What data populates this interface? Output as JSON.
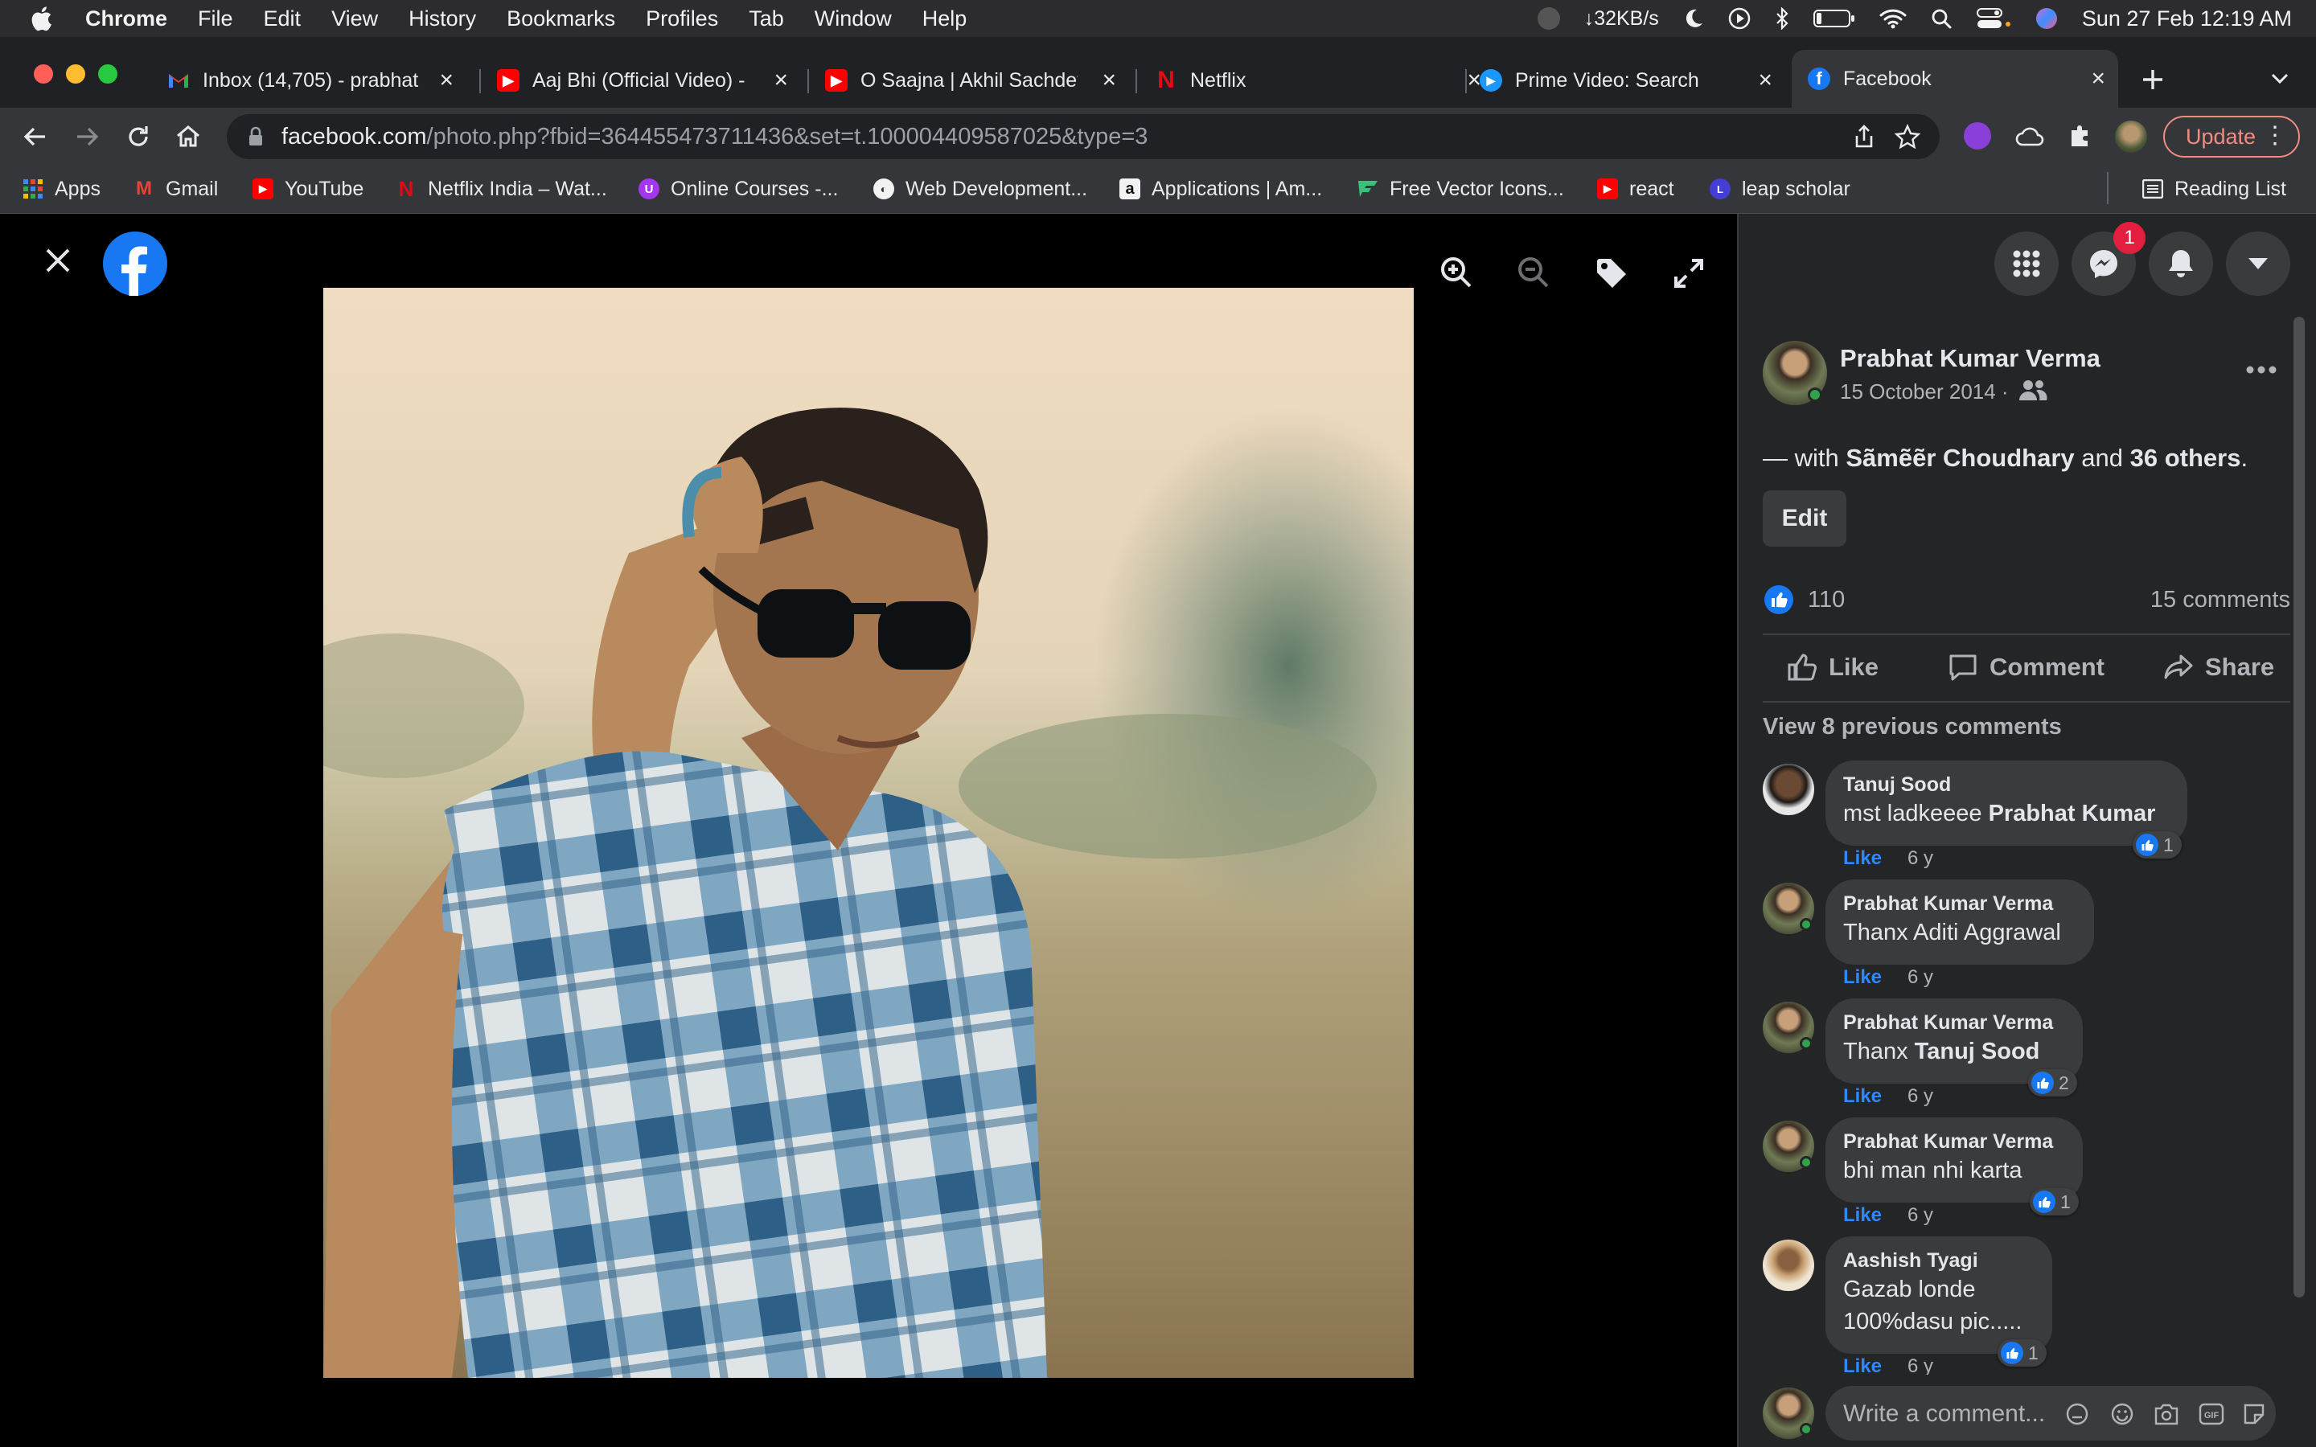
{
  "menubar": {
    "app_name": "Chrome",
    "menus": [
      "File",
      "Edit",
      "View",
      "History",
      "Bookmarks",
      "Profiles",
      "Tab",
      "Window",
      "Help"
    ],
    "network_speed": "↓32KB/s",
    "datetime": "Sun 27 Feb  12:19 AM"
  },
  "tabs": [
    {
      "title": "Inbox (14,705) - prabhat",
      "icon": "gmail-icon"
    },
    {
      "title": "Aaj Bhi (Official Video) -",
      "icon": "youtube-icon"
    },
    {
      "title": "O Saajna | Akhil Sachdev",
      "icon": "youtube-icon"
    },
    {
      "title": "Netflix",
      "icon": "netflix-icon"
    },
    {
      "title": "Prime Video: Search",
      "icon": "prime-video-icon"
    },
    {
      "title": "Facebook",
      "icon": "facebook-icon",
      "active": true
    }
  ],
  "address_bar": {
    "host": "facebook.com",
    "path": "/photo.php?fbid=364455473711436&set=t.100004409587025&type=3"
  },
  "toolbar": {
    "update_label": "Update"
  },
  "bookmarks": [
    {
      "label": "Apps",
      "icon": "apps-grid-icon"
    },
    {
      "label": "Gmail",
      "icon": "gmail-icon"
    },
    {
      "label": "YouTube",
      "icon": "youtube-icon"
    },
    {
      "label": "Netflix India – Wat...",
      "icon": "netflix-icon"
    },
    {
      "label": "Online Courses -...",
      "icon": "udemy-icon"
    },
    {
      "label": "Web Development...",
      "icon": "web-dev-icon"
    },
    {
      "label": "Applications | Am...",
      "icon": "amazon-icon"
    },
    {
      "label": "Free Vector Icons...",
      "icon": "flaticon-icon"
    },
    {
      "label": "react",
      "icon": "youtube-icon"
    },
    {
      "label": "leap scholar",
      "icon": "leap-icon"
    },
    {
      "label": "Reading List",
      "icon": "reading-list-icon"
    }
  ],
  "header": {
    "messenger_badge": "1"
  },
  "post": {
    "author": "Prabhat Kumar Verma",
    "date": "15 October 2014 ·",
    "with_prefix": "— with",
    "with_person": "Sãmẽẽr Choudhary",
    "with_and": "and",
    "with_others": "36 others",
    "with_suffix": ".",
    "edit_label": "Edit",
    "like_count": "110",
    "comment_count": "15 comments",
    "actions": {
      "like": "Like",
      "comment": "Comment",
      "share": "Share"
    },
    "view_previous": "View 8 previous comments"
  },
  "comments": [
    {
      "name": "Tanuj Sood",
      "text": "mst ladkeeee",
      "bold_tail": "Prabhat Kumar",
      "like": "Like",
      "time": "6 y",
      "reactions": "1"
    },
    {
      "name": "Prabhat Kumar Verma",
      "text": "Thanx Aditi Aggrawal",
      "like": "Like",
      "time": "6 y"
    },
    {
      "name": "Prabhat Kumar Verma",
      "text": "Thanx",
      "bold_tail": "Tanuj Sood",
      "like": "Like",
      "time": "6 y",
      "reactions": "2"
    },
    {
      "name": "Prabhat Kumar Verma",
      "text": "bhi man nhi karta",
      "like": "Like",
      "time": "6 y",
      "reactions": "1"
    },
    {
      "name": "Aashish Tyagi",
      "text": "Gazab londe",
      "text2": "100%dasu pic.....",
      "like": "Like",
      "time": "6 y",
      "reactions": "1"
    }
  ],
  "comment_input": {
    "placeholder": "Write a comment..."
  },
  "colors": {
    "fb_blue": "#1877f2",
    "panel_bg": "#242526",
    "bubble_bg": "#3a3b3c",
    "link_blue": "#2e89ff"
  }
}
